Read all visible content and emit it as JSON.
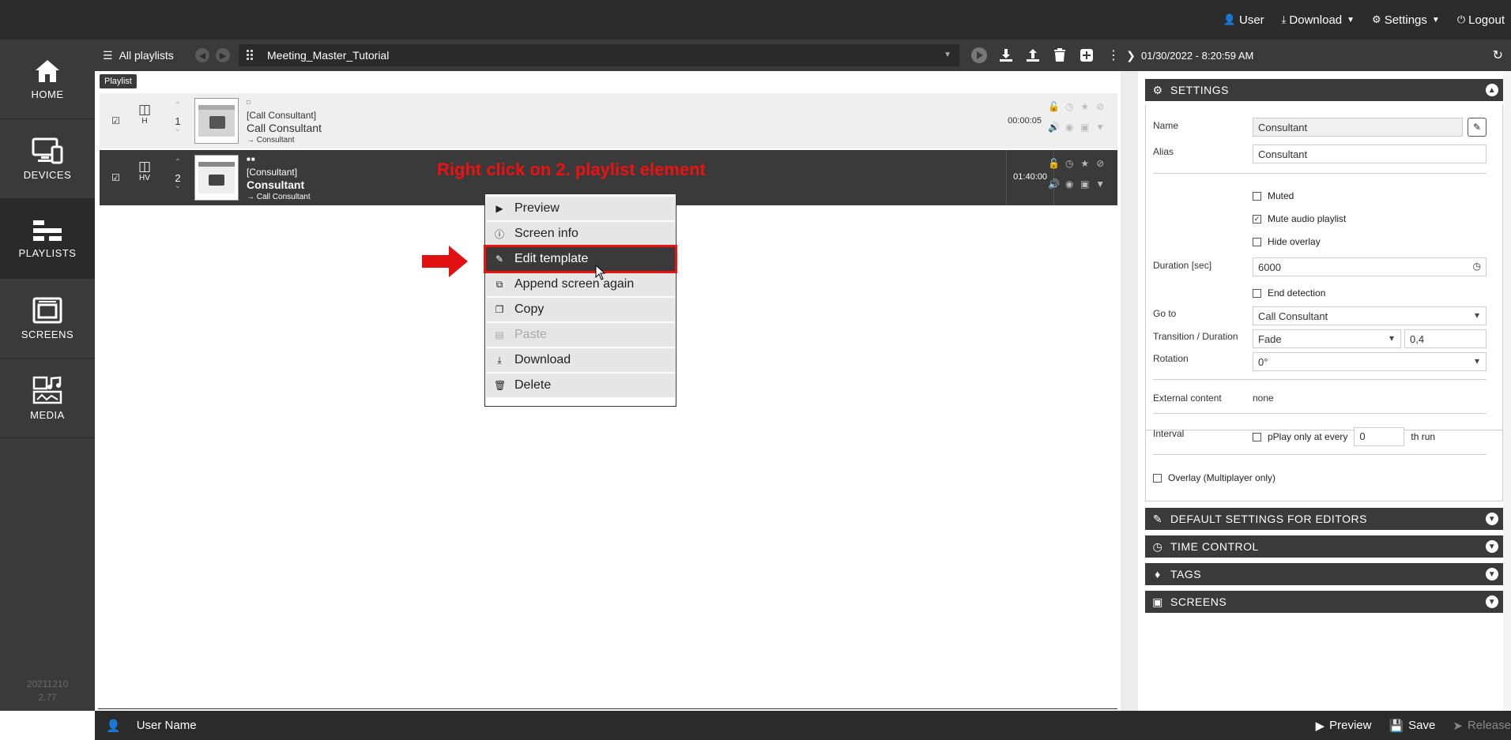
{
  "topnav": {
    "user": "User",
    "download": "Download",
    "settings": "Settings",
    "logout": "Logout"
  },
  "leftnav": {
    "items": [
      {
        "label": "HOME",
        "icon": "home-icon"
      },
      {
        "label": "DEVICES",
        "icon": "devices-icon"
      },
      {
        "label": "PLAYLISTS",
        "icon": "playlists-icon"
      },
      {
        "label": "SCREENS",
        "icon": "screens-icon"
      },
      {
        "label": "MEDIA",
        "icon": "media-icon"
      }
    ],
    "active": "PLAYLISTS",
    "version_line1": "20211210",
    "version_line2": "2.77"
  },
  "toolbar": {
    "all_playlists": "All playlists",
    "current_playlist": "Meeting_Master_Tutorial"
  },
  "playlist": {
    "badge": "Playlist",
    "rows": [
      {
        "format": "H",
        "index": "1",
        "tag": "[Call Consultant]",
        "name": "Call Consultant",
        "goto": "→ Consultant",
        "duration": "00:00:05",
        "selected": false
      },
      {
        "format": "HV",
        "index": "2",
        "tag": "[Consultant]",
        "name": "Consultant",
        "goto": "→ Call Consultant",
        "duration": "01:40:00",
        "selected": true
      }
    ]
  },
  "annotation": {
    "instruction": "Right click on 2. playlist element",
    "accent_color": "#e11111"
  },
  "context_menu": {
    "items": [
      {
        "label": "Preview",
        "icon": "play-circle-icon",
        "state": "normal"
      },
      {
        "label": "Screen info",
        "icon": "info-circle-icon",
        "state": "normal"
      },
      {
        "label": "Edit template",
        "icon": "edit-icon",
        "state": "highlighted"
      },
      {
        "label": "Append screen again",
        "icon": "duplicate-icon",
        "state": "normal"
      },
      {
        "label": "Copy",
        "icon": "copy-icon",
        "state": "normal"
      },
      {
        "label": "Paste",
        "icon": "paste-icon",
        "state": "disabled"
      },
      {
        "label": "Download",
        "icon": "download-icon",
        "state": "normal"
      },
      {
        "label": "Delete",
        "icon": "trash-icon",
        "state": "normal"
      }
    ]
  },
  "right_panel": {
    "timestamp": "01/30/2022 - 8:20:59 AM",
    "settings": {
      "title": "SETTINGS",
      "name_label": "Name",
      "name_value": "Consultant",
      "alias_label": "Alias",
      "alias_value": "Consultant",
      "muted_label": "Muted",
      "mute_audio_label": "Mute audio playlist",
      "hide_overlay_label": "Hide overlay",
      "duration_label": "Duration [sec]",
      "duration_value": "6000",
      "end_detection_label": "End detection",
      "goto_label": "Go to",
      "goto_value": "Call Consultant",
      "transition_label": "Transition / Duration",
      "transition_value": "Fade",
      "transition_duration": "0,4",
      "rotation_label": "Rotation",
      "rotation_value": "0°",
      "external_label": "External content",
      "external_value": "none",
      "interval_label": "Interval",
      "interval_prefix": "pPlay only at every",
      "interval_value": "0",
      "interval_suffix": "th run",
      "overlay_label": "Overlay (Multiplayer only)"
    },
    "sections": [
      {
        "title": "DEFAULT SETTINGS FOR EDITORS",
        "icon": "edit-icon"
      },
      {
        "title": "TIME CONTROL",
        "icon": "clock-icon"
      },
      {
        "title": "TAGS",
        "icon": "tags-icon"
      },
      {
        "title": "SCREENS",
        "icon": "screens-icon"
      }
    ]
  },
  "bottombar": {
    "user_name": "User Name",
    "preview": "Preview",
    "save": "Save",
    "release": "Release"
  }
}
